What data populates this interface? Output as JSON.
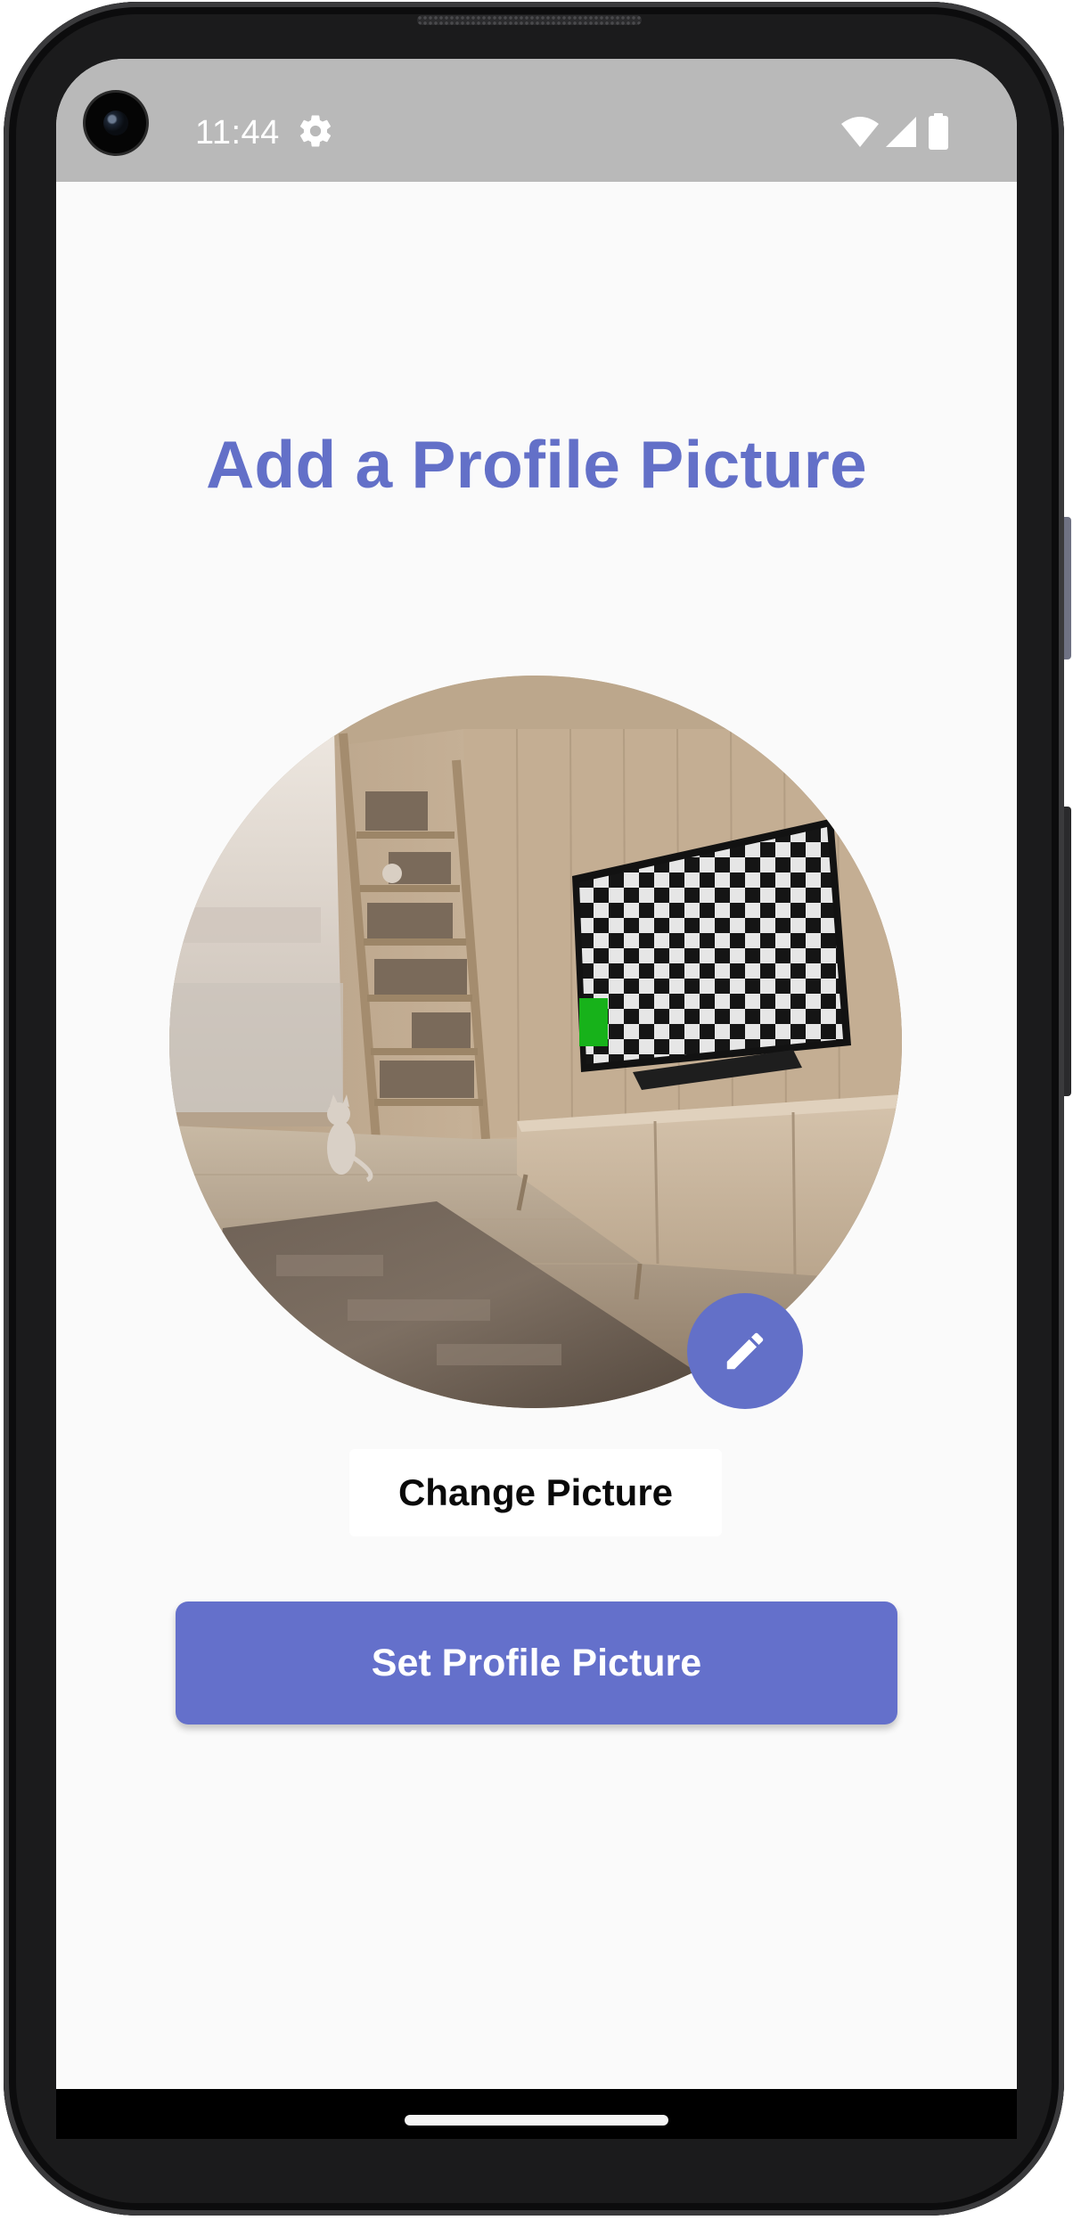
{
  "status_bar": {
    "time": "11:44",
    "icons": [
      "settings-icon",
      "wifi-icon",
      "signal-icon",
      "battery-icon"
    ]
  },
  "page": {
    "title": "Add a Profile Picture"
  },
  "avatar": {
    "description_icon": "profile-picture-image",
    "edit_icon": "pencil-icon"
  },
  "actions": {
    "change_label": "Change Picture",
    "set_label": "Set Profile Picture"
  },
  "colors": {
    "accent": "#6370c8",
    "background": "#fafafa",
    "status_bar": "#b9b9b9"
  }
}
